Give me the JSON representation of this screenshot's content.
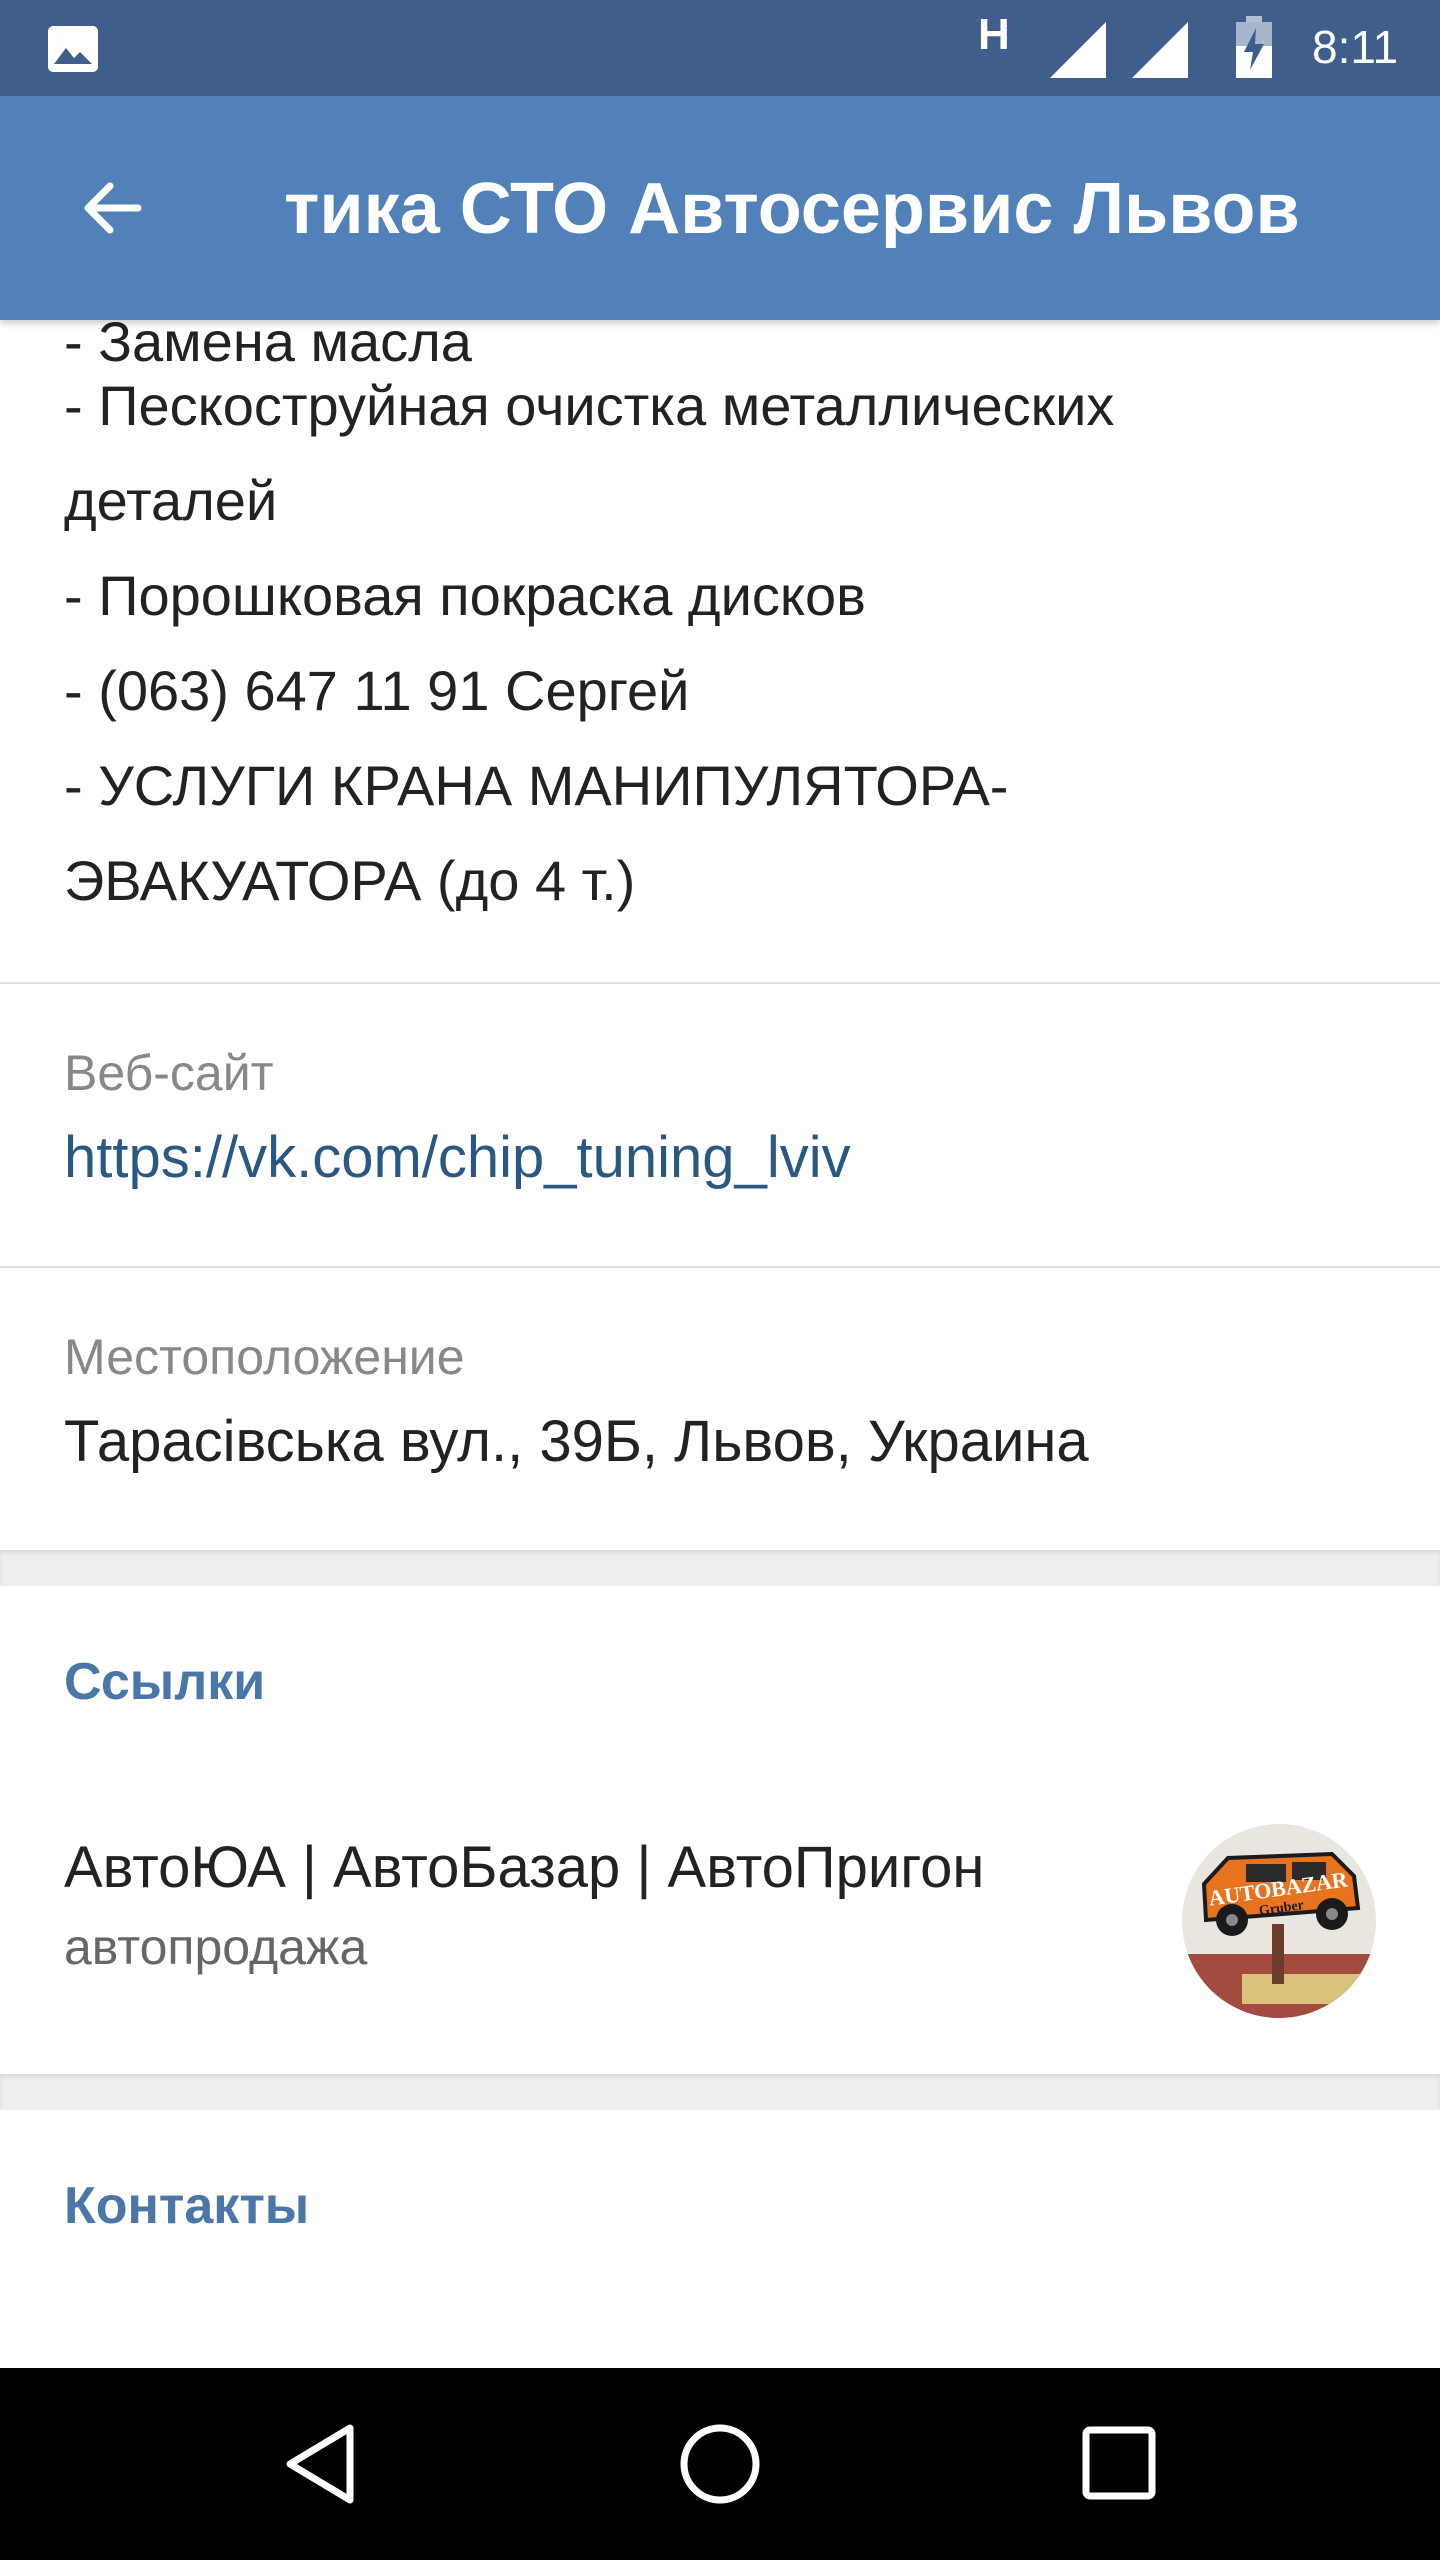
{
  "status_bar": {
    "network_indicator": "H",
    "time": "8:11",
    "icons": [
      "gallery-icon",
      "signal-icon",
      "signal-icon",
      "battery-charging-icon"
    ]
  },
  "app_bar": {
    "title": "Диагностика СТО Автосервис Львов",
    "back_icon": "arrow-left-icon"
  },
  "description": {
    "clipped_line": "- Замена масла",
    "lines": [
      "- Пескоструйная очистка металлических",
      "деталей",
      "- Порошковая покраска дисков",
      "- (063) 647 11 91 Сергей",
      "- УСЛУГИ КРАНА МАНИПУЛЯТОРА-",
      "ЭВАКУАТОРА (до 4 т.)"
    ]
  },
  "website": {
    "label": "Веб-сайт",
    "value": "https://vk.com/chip_tuning_lviv"
  },
  "location": {
    "label": "Местоположение",
    "value": "Тарасівська вул., 39Б, Львов, Украина"
  },
  "links_section": {
    "title": "Ссылки",
    "items": [
      {
        "title": "АвтоЮА | АвтоБазар | АвтоПригон",
        "subtitle": "автопродажа",
        "avatar_text": "AUTOBAZAR",
        "avatar_sub": "Gruber"
      }
    ]
  },
  "contacts_section": {
    "title": "Контакты"
  },
  "nav_bar": {
    "icons": [
      "nav-back-icon",
      "nav-home-icon",
      "nav-recents-icon"
    ]
  },
  "colors": {
    "status_bar": "#3f5e8c",
    "app_bar": "#5181b8",
    "link": "#2a5885",
    "section_title": "#4a76a8"
  }
}
